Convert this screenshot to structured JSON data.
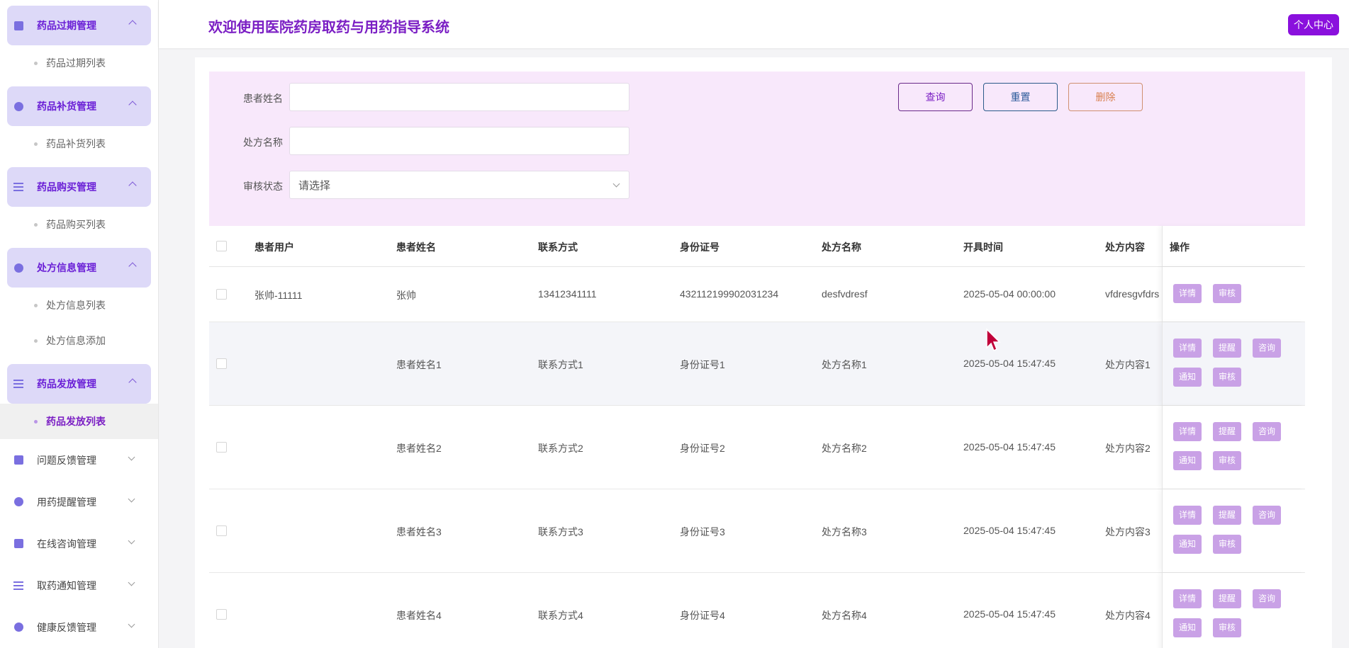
{
  "sidebar": {
    "groups": [
      {
        "title": "药品过期管理",
        "icon": "document-icon",
        "items": [
          "药品过期列表"
        ]
      },
      {
        "title": "药品补货管理",
        "icon": "stopwatch-icon",
        "items": [
          "药品补货列表"
        ]
      },
      {
        "title": "药品购买管理",
        "icon": "list-icon",
        "items": [
          "药品购买列表"
        ]
      },
      {
        "title": "处方信息管理",
        "icon": "database-icon",
        "items": [
          "处方信息列表",
          "处方信息添加"
        ]
      },
      {
        "title": "药品发放管理",
        "icon": "list-icon",
        "items": [
          "药品发放列表"
        ]
      }
    ],
    "plain": [
      {
        "title": "问题反馈管理",
        "icon": "inbox-icon"
      },
      {
        "title": "用药提醒管理",
        "icon": "stopwatch-icon"
      },
      {
        "title": "在线咨询管理",
        "icon": "edit-document-icon"
      },
      {
        "title": "取药通知管理",
        "icon": "list-icon"
      },
      {
        "title": "健康反馈管理",
        "icon": "database-icon"
      }
    ]
  },
  "header": {
    "title": "欢迎使用医院药房取药与用药指导系统",
    "profile": "个人中心"
  },
  "search": {
    "patient_name_label": "患者姓名",
    "prescription_name_label": "处方名称",
    "review_status_label": "审核状态",
    "review_status_value": "请选择",
    "query_button": "查询",
    "reset_button": "重置",
    "delete_button": "删除"
  },
  "table": {
    "columns": [
      "患者用户",
      "患者姓名",
      "联系方式",
      "身份证号",
      "处方名称",
      "开具时间",
      "处方内容",
      "操作"
    ],
    "rows": [
      {
        "user": "张帅-11111",
        "name": "张帅",
        "phone": "13412341111",
        "idcard": "432112199902031234",
        "pname": "desfvdresf",
        "time": "2025-05-04 00:00:00",
        "content": "vfdresgvfdrs",
        "ops": [
          "详情",
          "审核"
        ]
      },
      {
        "user": "",
        "name": "患者姓名1",
        "phone": "联系方式1",
        "idcard": "身份证号1",
        "pname": "处方名称1",
        "time": "2025-05-04 15:47:45",
        "content": "处方内容1",
        "ops": [
          "详情",
          "提醒",
          "咨询",
          "通知",
          "审核"
        ]
      },
      {
        "user": "",
        "name": "患者姓名2",
        "phone": "联系方式2",
        "idcard": "身份证号2",
        "pname": "处方名称2",
        "time": "2025-05-04 15:47:45",
        "content": "处方内容2",
        "ops": [
          "详情",
          "提醒",
          "咨询",
          "通知",
          "审核"
        ]
      },
      {
        "user": "",
        "name": "患者姓名3",
        "phone": "联系方式3",
        "idcard": "身份证号3",
        "pname": "处方名称3",
        "time": "2025-05-04 15:47:45",
        "content": "处方内容3",
        "ops": [
          "详情",
          "提醒",
          "咨询",
          "通知",
          "审核"
        ]
      },
      {
        "user": "",
        "name": "患者姓名4",
        "phone": "联系方式4",
        "idcard": "身份证号4",
        "pname": "处方名称4",
        "time": "2025-05-04 15:47:45",
        "content": "处方内容4",
        "ops": [
          "详情",
          "提醒",
          "咨询",
          "通知",
          "审核"
        ]
      }
    ]
  },
  "colors": {
    "accent": "#7b1fc4",
    "profile_button": "#8a10dd",
    "search_bg": "#f8e8fb",
    "op_button": "#c9a1e6",
    "menu_active_bg": "#ddd9f8"
  }
}
